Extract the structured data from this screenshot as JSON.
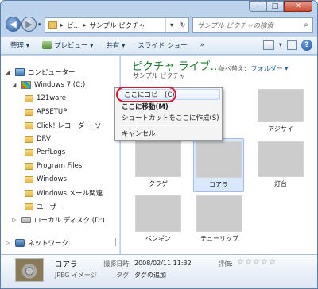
{
  "window": {
    "minimize_icon": "–",
    "maximize_icon": "□",
    "close_icon": "✕"
  },
  "address_bar": {
    "back_icon": "◀",
    "forward_icon": "▶",
    "dropdown_icon": "▾",
    "crumb_overflow": "ビ...",
    "sep1": "▸",
    "sep2": "▸",
    "crumb": "サンプル ピクチャ",
    "dropdown2": "▾",
    "refresh_icon": "↻"
  },
  "search": {
    "placeholder": "サンプル ピクチャの検索",
    "icon": "⌕"
  },
  "toolbar": {
    "organize": "整理 ▾",
    "preview": "プレビュー ▾",
    "share": "共有 ▾",
    "slideshow": "スライド ショー",
    "more": "»",
    "help": "?",
    "views_caret": "▾"
  },
  "nav": {
    "computer": "コンピューター",
    "drive_c": "Windows 7 (C:)",
    "folders": [
      "121ware",
      "APSETUP",
      "Click! レコーダー_ソ",
      "DRV",
      "PerfLogs",
      "Program Files",
      "Windows",
      "Windows メール関連",
      "ユーザー"
    ],
    "local_disk": "ローカル ディスク (D:)",
    "network": "ネットワーク",
    "expanded": "◢",
    "collapsed": "▷"
  },
  "library": {
    "title": "ピクチャ ライブ...",
    "subtitle": "サンプル ピクチャ",
    "arrange_label": "並べ替え:",
    "arrange_value": "フォルダー ▾"
  },
  "thumbnails": [
    {
      "label": "アジサイ"
    },
    {
      "label": "クラゲ"
    },
    {
      "label": "コアラ"
    },
    {
      "label": "灯台"
    },
    {
      "label": "ペンギン"
    },
    {
      "label": "チューリップ"
    }
  ],
  "context_menu": {
    "items": [
      "ここにコピー(C)",
      "ここに移動(M)",
      "ショートカットをここに作成(S)",
      "キャンセル"
    ]
  },
  "details": {
    "name": "コアラ",
    "type": "JPEG イメージ",
    "date_label": "撮影日時:",
    "date_value": "2008/02/11 11:32",
    "tag_label": "タグ:",
    "tag_value": "タグの追加",
    "rating_label": "評価:",
    "rating_stars": "☆",
    "rating": 0
  }
}
